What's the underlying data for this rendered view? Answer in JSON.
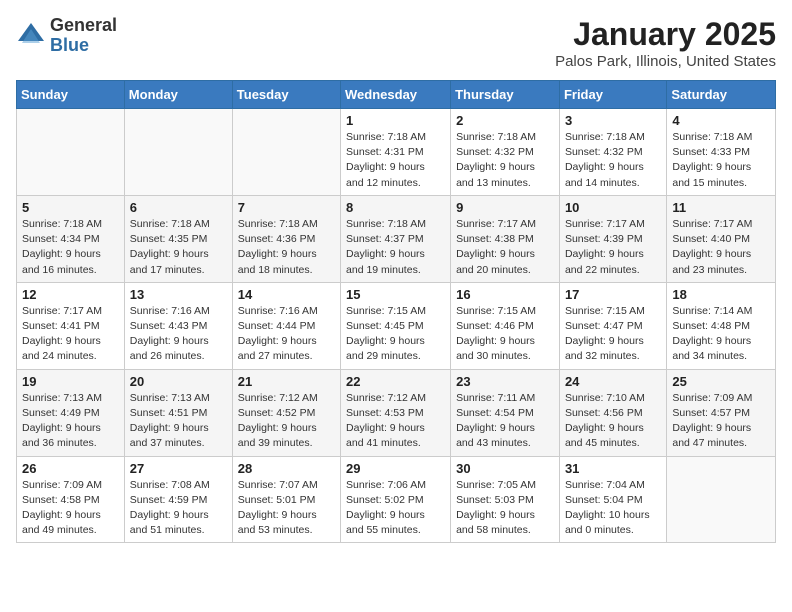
{
  "header": {
    "logo_general": "General",
    "logo_blue": "Blue",
    "title": "January 2025",
    "subtitle": "Palos Park, Illinois, United States"
  },
  "weekdays": [
    "Sunday",
    "Monday",
    "Tuesday",
    "Wednesday",
    "Thursday",
    "Friday",
    "Saturday"
  ],
  "weeks": [
    [
      {
        "day": "",
        "info": ""
      },
      {
        "day": "",
        "info": ""
      },
      {
        "day": "",
        "info": ""
      },
      {
        "day": "1",
        "info": "Sunrise: 7:18 AM\nSunset: 4:31 PM\nDaylight: 9 hours and 12 minutes."
      },
      {
        "day": "2",
        "info": "Sunrise: 7:18 AM\nSunset: 4:32 PM\nDaylight: 9 hours and 13 minutes."
      },
      {
        "day": "3",
        "info": "Sunrise: 7:18 AM\nSunset: 4:32 PM\nDaylight: 9 hours and 14 minutes."
      },
      {
        "day": "4",
        "info": "Sunrise: 7:18 AM\nSunset: 4:33 PM\nDaylight: 9 hours and 15 minutes."
      }
    ],
    [
      {
        "day": "5",
        "info": "Sunrise: 7:18 AM\nSunset: 4:34 PM\nDaylight: 9 hours and 16 minutes."
      },
      {
        "day": "6",
        "info": "Sunrise: 7:18 AM\nSunset: 4:35 PM\nDaylight: 9 hours and 17 minutes."
      },
      {
        "day": "7",
        "info": "Sunrise: 7:18 AM\nSunset: 4:36 PM\nDaylight: 9 hours and 18 minutes."
      },
      {
        "day": "8",
        "info": "Sunrise: 7:18 AM\nSunset: 4:37 PM\nDaylight: 9 hours and 19 minutes."
      },
      {
        "day": "9",
        "info": "Sunrise: 7:17 AM\nSunset: 4:38 PM\nDaylight: 9 hours and 20 minutes."
      },
      {
        "day": "10",
        "info": "Sunrise: 7:17 AM\nSunset: 4:39 PM\nDaylight: 9 hours and 22 minutes."
      },
      {
        "day": "11",
        "info": "Sunrise: 7:17 AM\nSunset: 4:40 PM\nDaylight: 9 hours and 23 minutes."
      }
    ],
    [
      {
        "day": "12",
        "info": "Sunrise: 7:17 AM\nSunset: 4:41 PM\nDaylight: 9 hours and 24 minutes."
      },
      {
        "day": "13",
        "info": "Sunrise: 7:16 AM\nSunset: 4:43 PM\nDaylight: 9 hours and 26 minutes."
      },
      {
        "day": "14",
        "info": "Sunrise: 7:16 AM\nSunset: 4:44 PM\nDaylight: 9 hours and 27 minutes."
      },
      {
        "day": "15",
        "info": "Sunrise: 7:15 AM\nSunset: 4:45 PM\nDaylight: 9 hours and 29 minutes."
      },
      {
        "day": "16",
        "info": "Sunrise: 7:15 AM\nSunset: 4:46 PM\nDaylight: 9 hours and 30 minutes."
      },
      {
        "day": "17",
        "info": "Sunrise: 7:15 AM\nSunset: 4:47 PM\nDaylight: 9 hours and 32 minutes."
      },
      {
        "day": "18",
        "info": "Sunrise: 7:14 AM\nSunset: 4:48 PM\nDaylight: 9 hours and 34 minutes."
      }
    ],
    [
      {
        "day": "19",
        "info": "Sunrise: 7:13 AM\nSunset: 4:49 PM\nDaylight: 9 hours and 36 minutes."
      },
      {
        "day": "20",
        "info": "Sunrise: 7:13 AM\nSunset: 4:51 PM\nDaylight: 9 hours and 37 minutes."
      },
      {
        "day": "21",
        "info": "Sunrise: 7:12 AM\nSunset: 4:52 PM\nDaylight: 9 hours and 39 minutes."
      },
      {
        "day": "22",
        "info": "Sunrise: 7:12 AM\nSunset: 4:53 PM\nDaylight: 9 hours and 41 minutes."
      },
      {
        "day": "23",
        "info": "Sunrise: 7:11 AM\nSunset: 4:54 PM\nDaylight: 9 hours and 43 minutes."
      },
      {
        "day": "24",
        "info": "Sunrise: 7:10 AM\nSunset: 4:56 PM\nDaylight: 9 hours and 45 minutes."
      },
      {
        "day": "25",
        "info": "Sunrise: 7:09 AM\nSunset: 4:57 PM\nDaylight: 9 hours and 47 minutes."
      }
    ],
    [
      {
        "day": "26",
        "info": "Sunrise: 7:09 AM\nSunset: 4:58 PM\nDaylight: 9 hours and 49 minutes."
      },
      {
        "day": "27",
        "info": "Sunrise: 7:08 AM\nSunset: 4:59 PM\nDaylight: 9 hours and 51 minutes."
      },
      {
        "day": "28",
        "info": "Sunrise: 7:07 AM\nSunset: 5:01 PM\nDaylight: 9 hours and 53 minutes."
      },
      {
        "day": "29",
        "info": "Sunrise: 7:06 AM\nSunset: 5:02 PM\nDaylight: 9 hours and 55 minutes."
      },
      {
        "day": "30",
        "info": "Sunrise: 7:05 AM\nSunset: 5:03 PM\nDaylight: 9 hours and 58 minutes."
      },
      {
        "day": "31",
        "info": "Sunrise: 7:04 AM\nSunset: 5:04 PM\nDaylight: 10 hours and 0 minutes."
      },
      {
        "day": "",
        "info": ""
      }
    ]
  ]
}
